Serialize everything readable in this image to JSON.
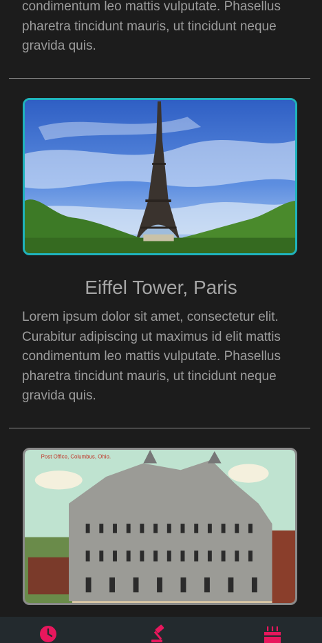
{
  "top_card": {
    "description_tail": "condimentum leo mattis vulputate. Phasellus pharetra tincidunt mauris, ut tincidunt neque gravida quis."
  },
  "cards": [
    {
      "title": "Eiffel Tower, Paris",
      "description": "Lorem ipsum dolor sit amet, consectetur elit. Curabitur adipiscing ut maximus id elit mattis condimentum leo mattis vulputate. Phasellus pharetra tincidunt mauris, ut tincidunt neque gravida quis.",
      "border_color": "#1fb3bd"
    },
    {
      "image_caption": "Post Office, Columbus, Ohio.",
      "border_color": "#8a8a8a"
    }
  ],
  "tabbar": {
    "accent": "#e8175d",
    "items": [
      {
        "icon": "clock-icon"
      },
      {
        "icon": "gavel-icon"
      },
      {
        "icon": "cake-icon"
      }
    ]
  }
}
